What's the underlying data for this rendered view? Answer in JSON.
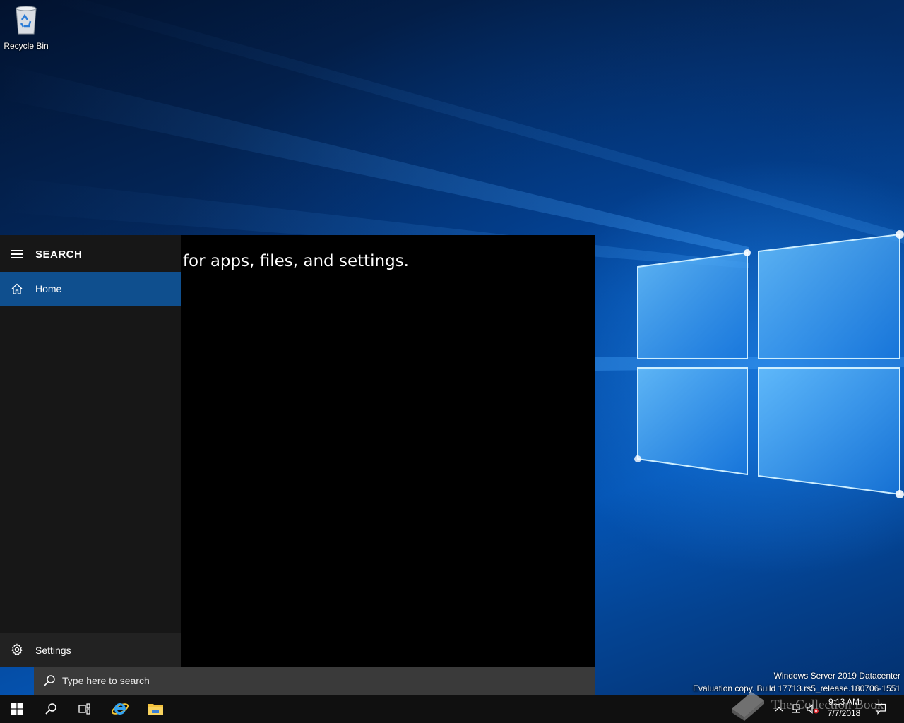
{
  "desktop": {
    "icons": [
      {
        "label": "Recycle Bin",
        "icon": "recycle-bin-icon"
      }
    ],
    "watermark": {
      "line1": "Windows Server 2019 Datacenter",
      "line2": "Evaluation copy. Build 17713.rs5_release.180706-1551"
    },
    "brand_watermark": "The Collection Book"
  },
  "search_flyout": {
    "nav": {
      "title": "SEARCH",
      "menu_icon": "hamburger-menu-icon",
      "items": [
        {
          "label": "Home",
          "icon": "home-icon",
          "selected": true
        }
      ],
      "footer": {
        "label": "Settings",
        "icon": "gear-icon"
      }
    },
    "hint_text": "Search for apps, files, and settings.",
    "search_box": {
      "icon": "search-icon",
      "value": "",
      "placeholder": "Type here to search"
    }
  },
  "taskbar": {
    "buttons": [
      {
        "name": "start",
        "icon": "windows-logo-icon"
      },
      {
        "name": "search",
        "icon": "search-icon"
      },
      {
        "name": "task-view",
        "icon": "task-view-icon"
      },
      {
        "name": "internet-explorer",
        "icon": "internet-explorer-icon"
      },
      {
        "name": "file-explorer",
        "icon": "folder-icon"
      }
    ],
    "tray": {
      "icons": [
        "chevron-up-icon",
        "network-icon",
        "volume-muted-icon"
      ],
      "time": "9:13 AM",
      "date": "7/7/2018",
      "action_center_icon": "notification-icon"
    }
  },
  "colors": {
    "accent": "#0f4f8e",
    "flyout_bg": "#000000",
    "nav_bg": "#171717",
    "searchbox_bg": "#3a3a3a",
    "taskbar_bg": "#101010"
  }
}
